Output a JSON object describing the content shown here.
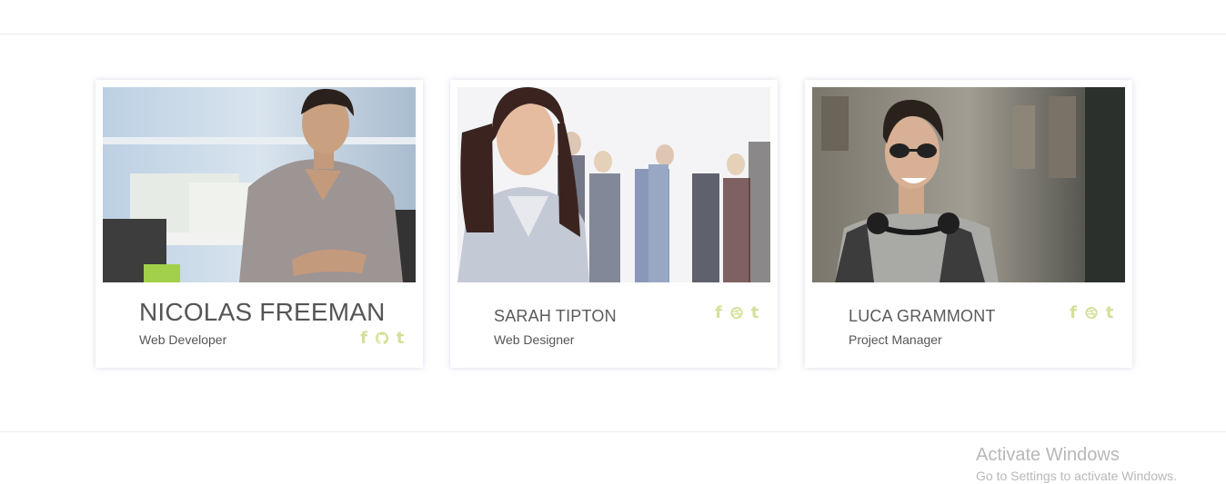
{
  "team": [
    {
      "name": "NICOLAS FREEMAN",
      "role": "Web Developer",
      "photo_alt": "Nicolas Freeman",
      "social": [
        "facebook-icon",
        "github-icon",
        "tumblr-icon"
      ]
    },
    {
      "name": "SARAH TIPTON",
      "role": "Web Designer",
      "photo_alt": "Sarah Tipton",
      "social": [
        "facebook-icon",
        "dribbble-icon",
        "tumblr-icon"
      ]
    },
    {
      "name": "LUCA GRAMMONT",
      "role": "Project Manager",
      "photo_alt": "Luca Grammont",
      "social": [
        "facebook-icon",
        "dribbble-icon",
        "tumblr-icon"
      ]
    }
  ],
  "watermark": {
    "title": "Activate Windows",
    "subtitle": "Go to Settings to activate Windows."
  },
  "colors": {
    "social_icon": "#d4e09a",
    "text": "#555555",
    "rule": "#ececec"
  }
}
